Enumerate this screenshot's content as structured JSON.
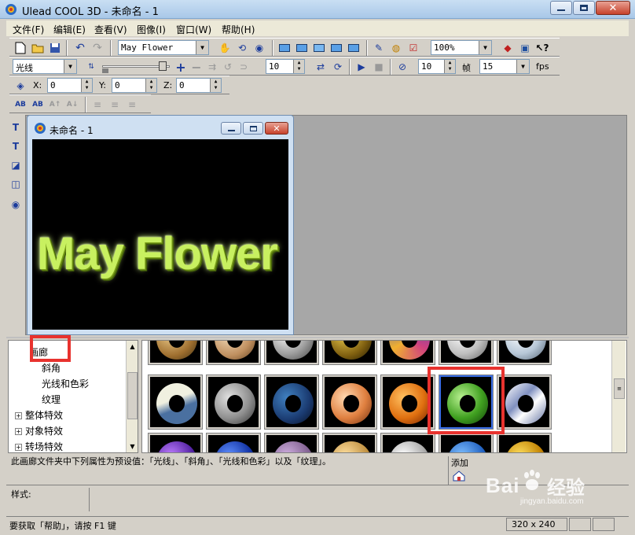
{
  "window": {
    "title": "Ulead COOL 3D - 未命名 - 1"
  },
  "menu": [
    "文件(F)",
    "编辑(E)",
    "查看(V)",
    "图像(I)",
    "窗口(W)",
    "帮助(H)"
  ],
  "toolbar": {
    "font_combo": "May Flower",
    "zoom_combo": "100%",
    "light_combo": "光线",
    "value_a": "10",
    "value_b": "10",
    "frame_label": "帧",
    "fps_value": "15",
    "fps_label": "fps",
    "x_label": "X:",
    "x_value": "0",
    "y_label": "Y:",
    "y_value": "0",
    "z_label": "Z:",
    "z_value": "0"
  },
  "document": {
    "title": "未命名 - 1",
    "canvas_text": "May Flower"
  },
  "tree": {
    "items": [
      {
        "label": "画廊",
        "indent": 2,
        "expandable": false,
        "selected": true
      },
      {
        "label": "斜角",
        "indent": 2,
        "expandable": false
      },
      {
        "label": "光线和色彩",
        "indent": 2,
        "expandable": false
      },
      {
        "label": "纹理",
        "indent": 2,
        "expandable": false
      },
      {
        "label": "整体特效",
        "indent": 0,
        "expandable": true
      },
      {
        "label": "对象特效",
        "indent": 0,
        "expandable": true
      },
      {
        "label": "转场特效",
        "indent": 0,
        "expandable": true
      }
    ]
  },
  "description": "此画廊文件夹中下列属性为预设值：「光线」、「斜角」、「光线和色彩」以及「纹理」。",
  "add_label": "添加",
  "style_label": "样式:",
  "status": {
    "hint": "要获取「帮助」，请按 F1 键",
    "resolution": "320 x 240"
  },
  "watermark": {
    "brand": "Bai",
    "suffix": "经验",
    "url": "jingyan.baidu.com"
  },
  "colors": {
    "highlight": "#e8322e",
    "text3d": "#c8f060"
  }
}
